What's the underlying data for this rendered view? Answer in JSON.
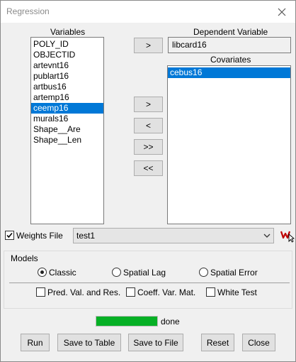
{
  "window": {
    "title": "Regression"
  },
  "colors": {
    "selection": "#0078d7",
    "progress": "#06b025",
    "weights_icon": "#c00000"
  },
  "variables": {
    "label": "Variables",
    "items": [
      "POLY_ID",
      "OBJECTID",
      "artevnt16",
      "publart16",
      "artbus16",
      "artemp16",
      "ceemp16",
      "murals16",
      "Shape__Are",
      "Shape__Len"
    ],
    "selected": "ceemp16"
  },
  "dependent": {
    "label": "Dependent Variable",
    "value": "libcard16",
    "move_label": ">"
  },
  "covariates": {
    "label": "Covariates",
    "items": [
      "cebus16"
    ],
    "selected": "cebus16"
  },
  "move_buttons": {
    "add": ">",
    "remove": "<",
    "add_all": ">>",
    "remove_all": "<<"
  },
  "weights": {
    "checkbox_label": "Weights File",
    "checked": true,
    "file": "test1",
    "icon": "weights-file-icon"
  },
  "models": {
    "label": "Models",
    "options": [
      "Classic",
      "Spatial Lag",
      "Spatial Error"
    ],
    "selected": "Classic",
    "outputs": [
      {
        "label": "Pred. Val. and Res.",
        "checked": false
      },
      {
        "label": "Coeff. Var. Mat.",
        "checked": false
      },
      {
        "label": "White Test",
        "checked": false
      }
    ]
  },
  "progress": {
    "fraction": 1.0,
    "status": "done"
  },
  "actions": {
    "run": "Run",
    "save_table": "Save to Table",
    "save_file": "Save to File",
    "reset": "Reset",
    "close": "Close"
  }
}
